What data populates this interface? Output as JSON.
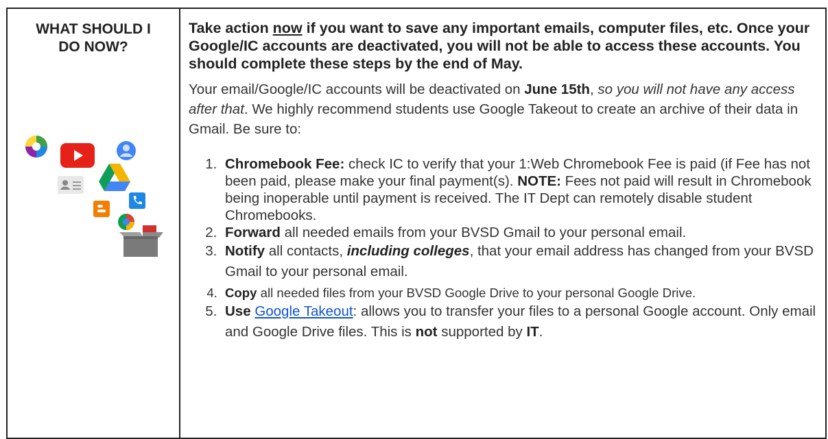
{
  "left": {
    "heading_line1": "WHAT SHOULD I",
    "heading_line2": "DO NOW?"
  },
  "warning": {
    "part1": "Take action ",
    "now": "now",
    "part2": " if you want to save any important emails, computer files, etc. Once your Google/IC accounts are deactivated, you will not be able to access these accounts.  You should complete these steps by the end of May."
  },
  "intro": {
    "part1": "Your email/Google/IC accounts will be deactivated on ",
    "date": "June 15th",
    "part2": ", ",
    "italic": "so you will not have any access after that",
    "part3": ".  We highly recommend students use Google Takeout to create an archive of their data in Gmail. Be sure to:"
  },
  "steps": [
    {
      "bold": "Chromebook Fee:",
      "text_a": " check IC to verify that your 1:Web Chromebook Fee is paid (if Fee has not been paid, please make your final payment(s). ",
      "bold2": "NOTE:",
      "text_b": " Fees not paid will result in Chromebook being inoperable until payment is received. The IT Dept can remotely disable student Chromebooks."
    },
    {
      "bold": "Forward",
      "text_a": " all needed emails from your BVSD Gmail to your personal email."
    },
    {
      "bold": "Notify",
      "text_a": " all contacts, ",
      "italic_bold": "including colleges",
      "text_b": ", that your email address has changed from your BVSD Gmail to your personal email."
    },
    {
      "bold": "Copy",
      "text_a": " all needed files from your BVSD Google Drive to your personal Google Drive."
    },
    {
      "bold": "Use",
      "link": "Google Takeout",
      "text_a": ": allows you to transfer your files to a personal Google account. Only email and Google Drive files. This is ",
      "bold2": "not",
      "text_b": " supported by ",
      "bold3": "IT",
      "text_c": "."
    }
  ],
  "colors": {
    "link": "#1155cc",
    "youtube": "#e62117",
    "drive_green": "#0f9d58",
    "drive_yellow": "#f4b400",
    "drive_blue": "#4285f4",
    "blogger": "#f57d00"
  },
  "icons": [
    "picasa-icon",
    "youtube-icon",
    "profile-icon",
    "contacts-icon",
    "drive-icon",
    "blogger-icon",
    "voice-icon",
    "hangouts-icon",
    "box-icon"
  ]
}
